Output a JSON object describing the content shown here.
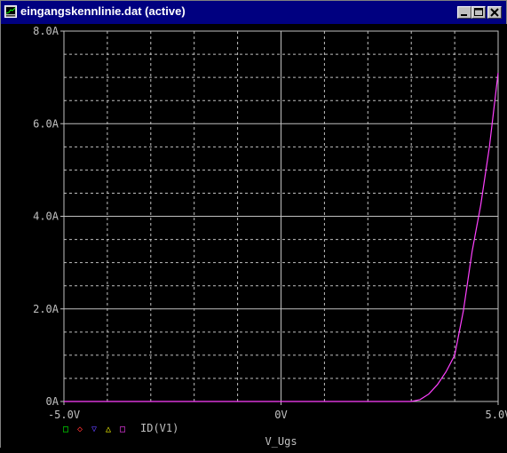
{
  "window": {
    "title": "eingangskennlinie.dat (active)",
    "icon": "probe-app-icon",
    "controls": [
      "minimize-icon",
      "maximize-icon",
      "close-icon"
    ]
  },
  "colors": {
    "background": "#000000",
    "grid": "#c0c0c0",
    "trace": "#ff40ff",
    "axis_text": "#c0c0c0",
    "titlebar": "#000080"
  },
  "legend": {
    "markers": [
      {
        "symbol": "□",
        "color": "#00ff00",
        "name": "square-marker"
      },
      {
        "symbol": "◇",
        "color": "#ff3030",
        "name": "diamond-marker"
      },
      {
        "symbol": "▽",
        "color": "#6040ff",
        "name": "triangle-down-marker"
      },
      {
        "symbol": "△",
        "color": "#ffff00",
        "name": "triangle-up-marker"
      },
      {
        "symbol": "□",
        "color": "#ff40ff",
        "name": "trace-marker"
      }
    ],
    "trace_label": "ID(V1)"
  },
  "chart_data": {
    "type": "line",
    "xlabel": "V_Ugs",
    "ylabel": "",
    "xlim": [
      -5.0,
      5.0
    ],
    "ylim": [
      0,
      8.0
    ],
    "x_ticks": [
      {
        "value": -5.0,
        "label": "-5.0V"
      },
      {
        "value": 0,
        "label": "0V"
      },
      {
        "value": 5.0,
        "label": "5.0V"
      }
    ],
    "y_ticks": [
      {
        "value": 0,
        "label": "0A"
      },
      {
        "value": 2.0,
        "label": "2.0A"
      },
      {
        "value": 4.0,
        "label": "4.0A"
      },
      {
        "value": 6.0,
        "label": "6.0A"
      },
      {
        "value": 8.0,
        "label": "8.0A"
      }
    ],
    "grid": true,
    "series": [
      {
        "name": "ID(V1)",
        "color": "#ff40ff",
        "x": [
          -5.0,
          3.0,
          3.2,
          3.4,
          3.6,
          3.8,
          4.0,
          4.2,
          4.4,
          4.6,
          4.8,
          5.0
        ],
        "y": [
          0,
          0,
          0.04,
          0.16,
          0.36,
          0.64,
          1.0,
          1.96,
          3.24,
          4.24,
          5.5,
          7.1
        ]
      }
    ]
  }
}
